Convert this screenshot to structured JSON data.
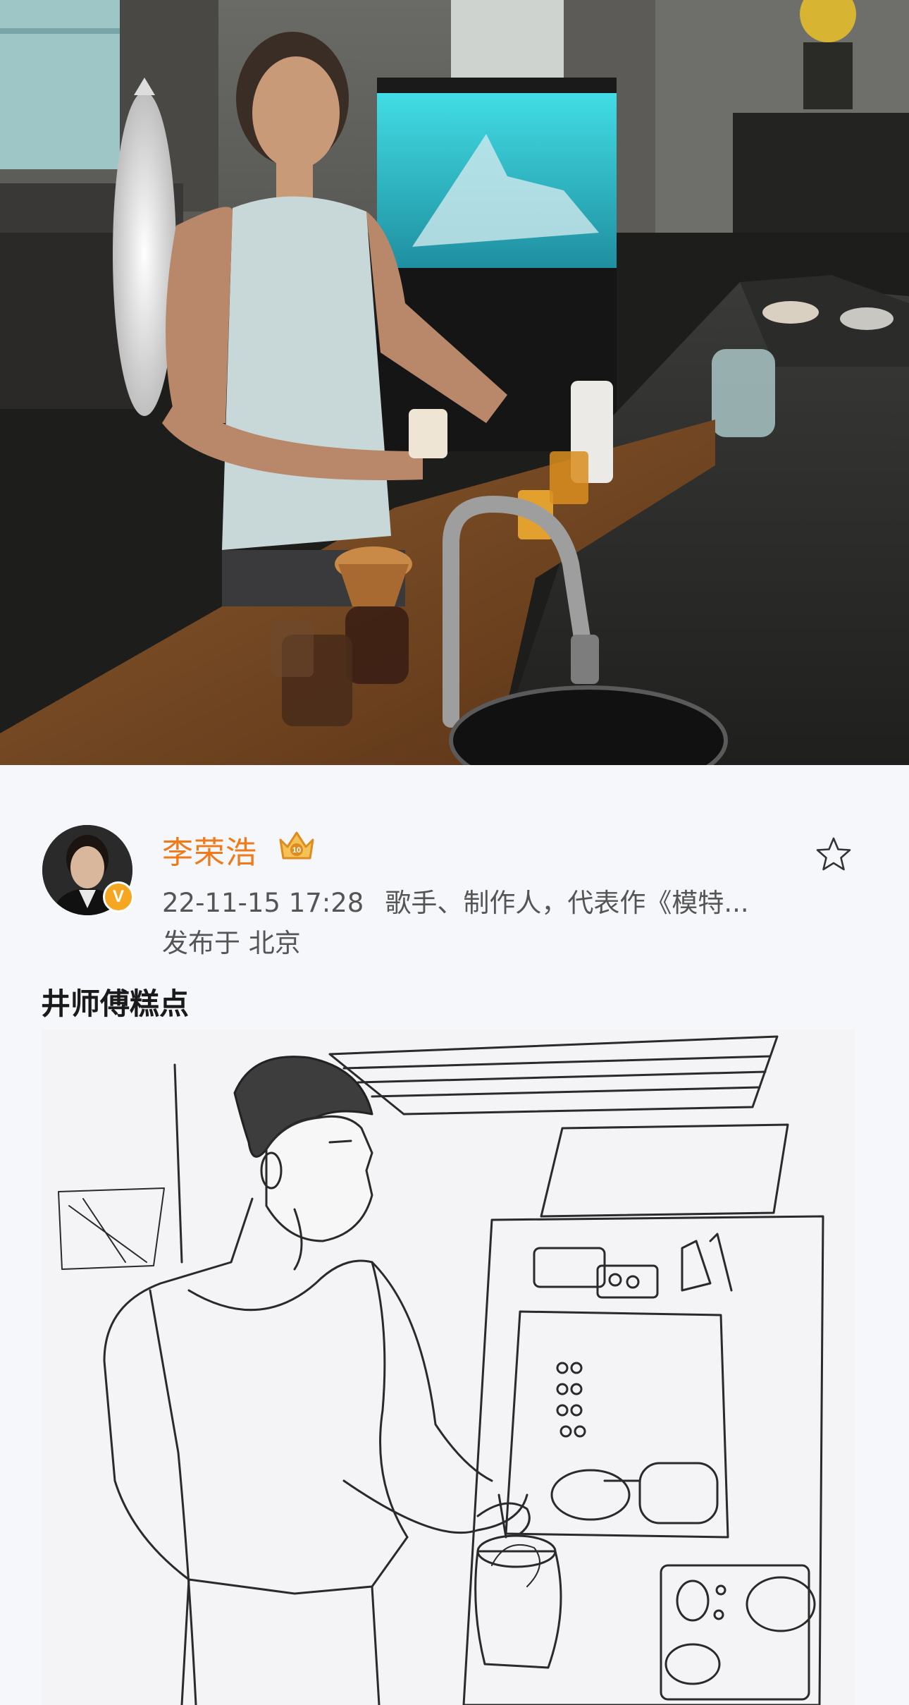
{
  "post": {
    "author_name": "李荣浩",
    "avatar_badge": "V",
    "timestamp": "22-11-15 17:28",
    "author_description": "歌手、制作人，代表作《模特...",
    "location": "发布于 北京",
    "text": "井师傅糕点",
    "icons": {
      "verified": "verified-v-badge",
      "member": "crown-membership-icon",
      "favorite": "star-outline-icon"
    }
  },
  "colors": {
    "author_name": "#ef7a1a",
    "badge": "#f5a623",
    "meta_text": "#555555",
    "background": "#f6f7fb"
  }
}
